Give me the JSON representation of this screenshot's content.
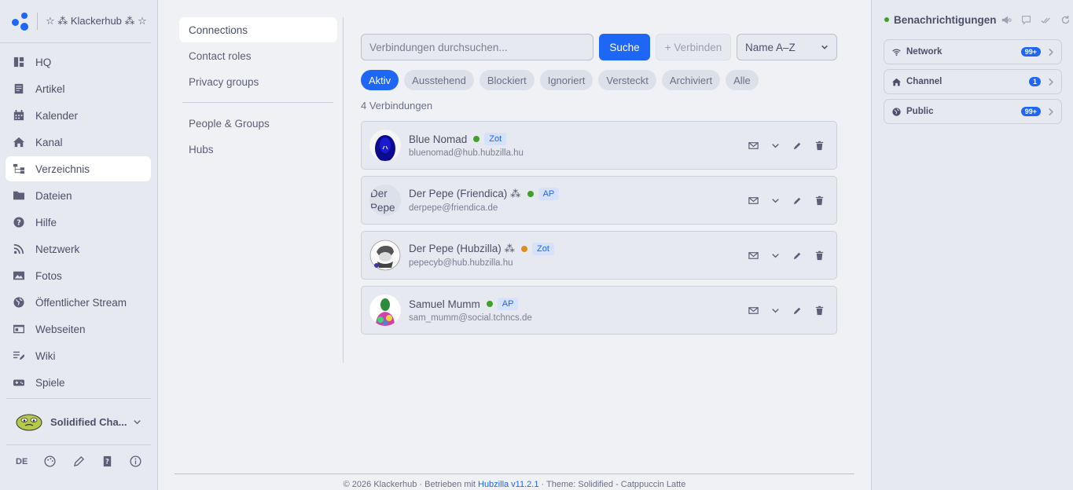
{
  "brand": {
    "title": "☆ ⁂ Klackerhub ⁂ ☆"
  },
  "sidebar": {
    "items": [
      {
        "label": "HQ",
        "icon": "hq-icon"
      },
      {
        "label": "Artikel",
        "icon": "article-icon"
      },
      {
        "label": "Kalender",
        "icon": "calendar-icon"
      },
      {
        "label": "Kanal",
        "icon": "home-icon"
      },
      {
        "label": "Verzeichnis",
        "icon": "directory-icon",
        "active": true
      },
      {
        "label": "Dateien",
        "icon": "folder-icon"
      },
      {
        "label": "Hilfe",
        "icon": "help-icon"
      },
      {
        "label": "Netzwerk",
        "icon": "rss-icon"
      },
      {
        "label": "Fotos",
        "icon": "image-icon"
      },
      {
        "label": "Öffentlicher Stream",
        "icon": "globe-icon"
      },
      {
        "label": "Webseiten",
        "icon": "webpage-icon"
      },
      {
        "label": "Wiki",
        "icon": "wiki-icon"
      },
      {
        "label": "Spiele",
        "icon": "gamepad-icon"
      }
    ],
    "profile_name": "Solidified Cha...",
    "lang": "DE"
  },
  "subnav": {
    "items": [
      "Connections",
      "Contact roles",
      "Privacy groups"
    ],
    "items2": [
      "People & Groups",
      "Hubs"
    ]
  },
  "main": {
    "search_placeholder": "Verbindungen durchsuchen...",
    "search_button": "Suche",
    "connect_button": "+ Verbinden",
    "sort_value": "Name A–Z",
    "filters": [
      "Aktiv",
      "Ausstehend",
      "Blockiert",
      "Ignoriert",
      "Versteckt",
      "Archiviert",
      "Alle"
    ],
    "count_text": "4 Verbindungen",
    "connections": [
      {
        "name": "Blue Nomad",
        "status_color": "#40a02b",
        "protocol": "Zot",
        "address": "bluenomad@hub.hubzilla.hu"
      },
      {
        "name": "Der Pepe (Friendica) ⁂",
        "status_color": "#40a02b",
        "protocol": "AP",
        "address": "derpepe@friendica.de",
        "avatar_text": "Der Pepe"
      },
      {
        "name": "Der Pepe (Hubzilla) ⁂",
        "status_color": "#df8e1d",
        "protocol": "Zot",
        "address": "pepecyb@hub.hubzilla.hu"
      },
      {
        "name": "Samuel Mumm",
        "status_color": "#40a02b",
        "protocol": "AP",
        "address": "sam_mumm@social.tchncs.de"
      }
    ]
  },
  "footer": {
    "prefix": "© 2026 Klackerhub · Betrieben mit ",
    "link": "Hubzilla v11.2.1",
    "suffix": " · Theme: Solidified - Catppuccin Latte"
  },
  "notifications": {
    "title": "Benachrichtigungen",
    "items": [
      {
        "label": "Network",
        "count": "99+",
        "icon": "wifi-icon"
      },
      {
        "label": "Channel",
        "count": "1",
        "icon": "home-icon"
      },
      {
        "label": "Public",
        "count": "99+",
        "icon": "globe-icon"
      }
    ]
  },
  "colors": {
    "accent": "#1e66f5",
    "online": "#40a02b",
    "away": "#df8e1d"
  }
}
